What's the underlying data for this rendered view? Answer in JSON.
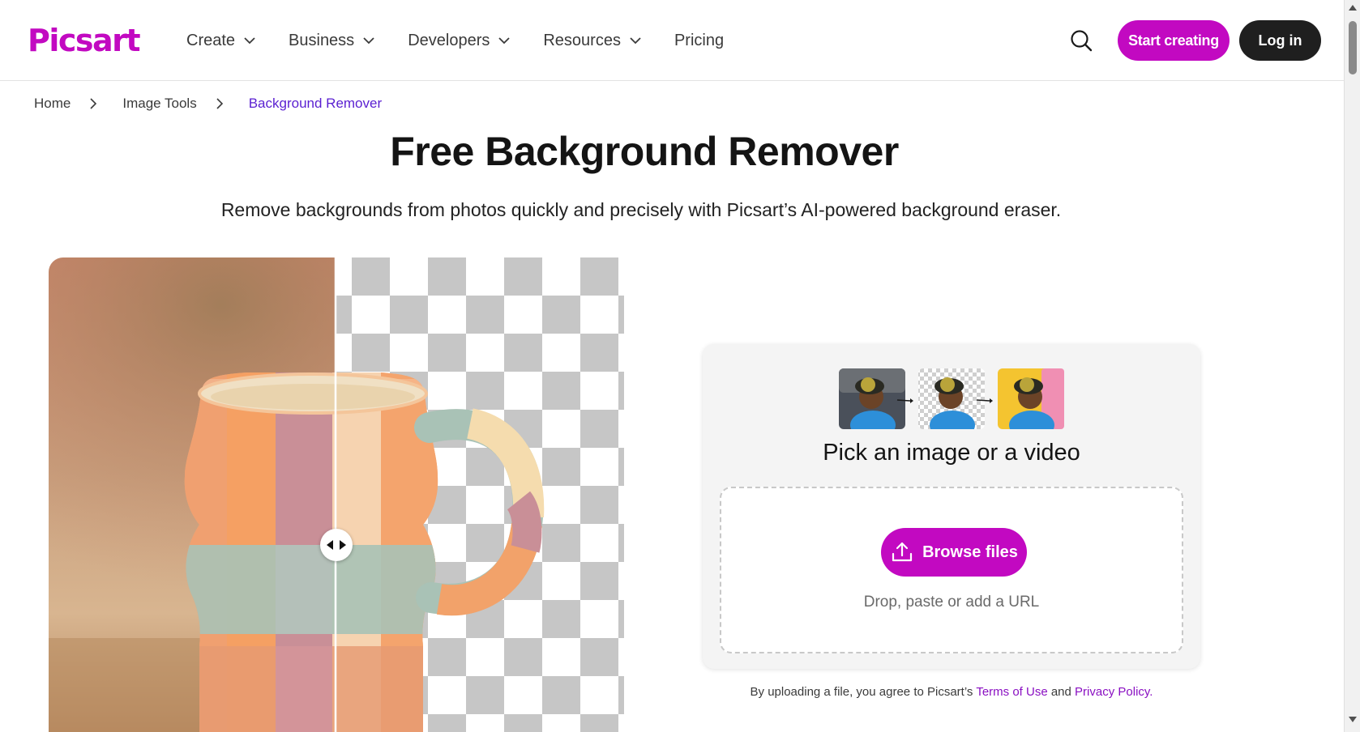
{
  "header": {
    "logo": "Picsart",
    "nav": [
      {
        "label": "Create",
        "has_dropdown": true
      },
      {
        "label": "Business",
        "has_dropdown": true
      },
      {
        "label": "Developers",
        "has_dropdown": true
      },
      {
        "label": "Resources",
        "has_dropdown": true
      },
      {
        "label": "Pricing",
        "has_dropdown": false
      }
    ],
    "start_label": "Start creating",
    "login_label": "Log in",
    "search_icon": "search-icon"
  },
  "breadcrumb": {
    "items": [
      "Home",
      "Image Tools",
      "Background Remover"
    ]
  },
  "hero": {
    "title": "Free Background Remover",
    "subtitle": "Remove backgrounds from photos quickly and precisely with Picsart’s AI-powered background eraser."
  },
  "upload": {
    "heading": "Pick an image or a video",
    "browse_label": "Browse files",
    "drop_text": "Drop, paste or add a URL",
    "legal_prefix": "By uploading a file, you agree to Picsart’s",
    "terms_label": "Terms of Use",
    "legal_and": "and",
    "privacy_label": "Privacy Policy."
  },
  "colors": {
    "brand": "#c209c1",
    "breadcrumb_current": "#5a1fd1",
    "dark_button": "#1f1f1f"
  }
}
